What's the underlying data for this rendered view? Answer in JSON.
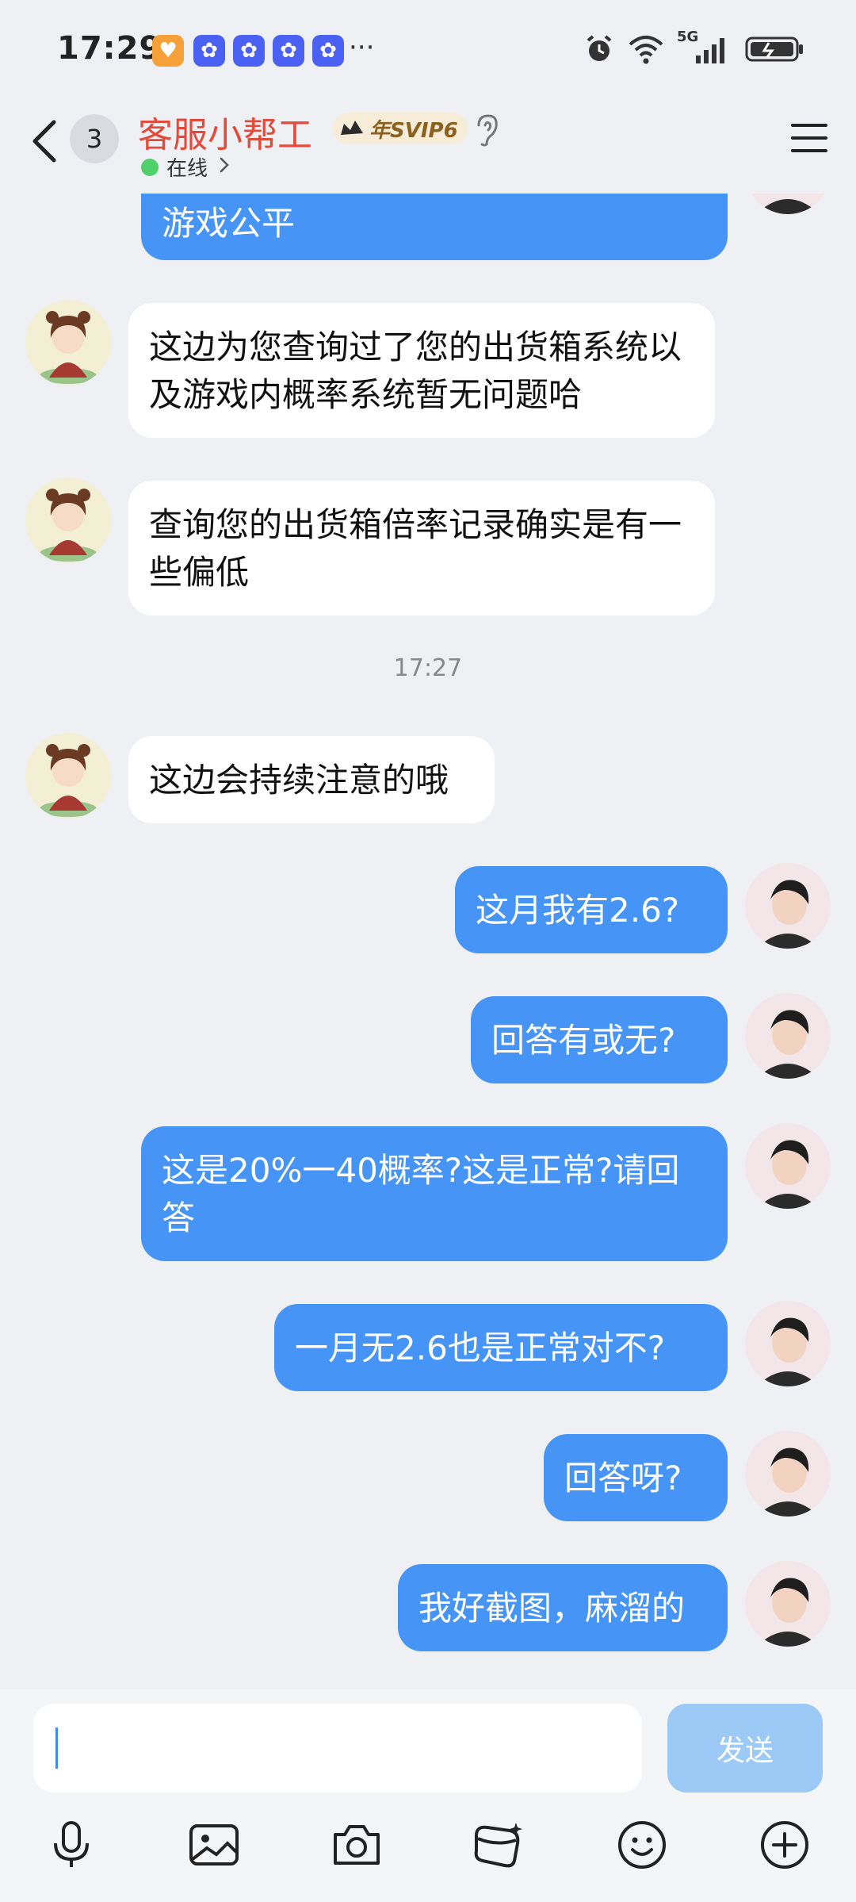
{
  "status_bar": {
    "time": "17:29",
    "more": "···",
    "network": "5G"
  },
  "header": {
    "unread_count": "3",
    "contact_name": "客服小帮工",
    "vip_label": "年SVIP6",
    "status_text": "在线"
  },
  "messages": [
    {
      "side": "out",
      "text": "游戏公平"
    },
    {
      "side": "in",
      "text": "这边为您查询过了您的出货箱系统以及游戏内概率系统暂无问题哈"
    },
    {
      "side": "in",
      "text": "查询您的出货箱倍率记录确实是有一些偏低"
    },
    {
      "side": "in",
      "text": "这边会持续注意的哦"
    },
    {
      "side": "out",
      "text": "这月我有2.6?"
    },
    {
      "side": "out",
      "text": "回答有或无?"
    },
    {
      "side": "out",
      "text": "这是20%一40概率?这是正常?请回答"
    },
    {
      "side": "out",
      "text": "一月无2.6也是正常对不?"
    },
    {
      "side": "out",
      "text": "回答呀?"
    },
    {
      "side": "out",
      "text": "我好截图，麻溜的"
    }
  ],
  "timestamp": "17:27",
  "input": {
    "placeholder": "",
    "send_label": "发送"
  },
  "toolbar": [
    "microphone-icon",
    "image-icon",
    "camera-icon",
    "red-packet-icon",
    "emoji-icon",
    "plus-icon"
  ],
  "colors": {
    "outgoing_bubble": "#4695f6",
    "incoming_bubble": "#ffffff",
    "background": "#eef0f4",
    "contact_name": "#e24a3b",
    "online": "#4fd06a",
    "send_disabled": "#9cc9f6"
  }
}
